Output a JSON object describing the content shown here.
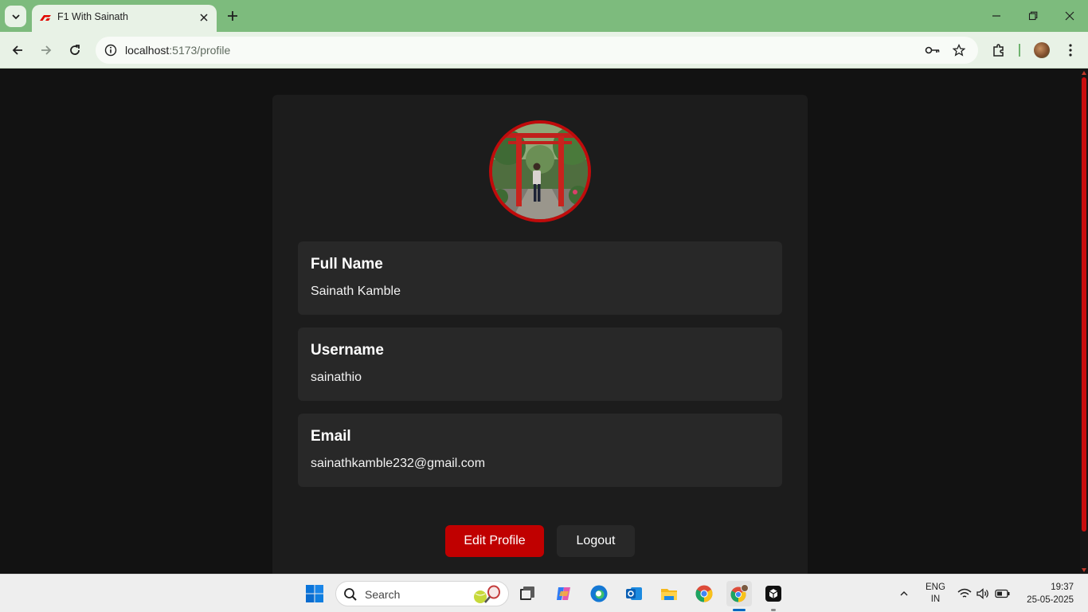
{
  "browser": {
    "tab_title": "F1 With Sainath",
    "url_host": "localhost",
    "url_path": ":5173/profile"
  },
  "profile": {
    "fields": [
      {
        "label": "Full Name",
        "value": "Sainath Kamble"
      },
      {
        "label": "Username",
        "value": "sainathio"
      },
      {
        "label": "Email",
        "value": "sainathkamble232@gmail.com"
      }
    ],
    "edit_button": "Edit Profile",
    "logout_button": "Logout"
  },
  "taskbar": {
    "search_placeholder": "Search",
    "lang_line1": "ENG",
    "lang_line2": "IN",
    "time": "19:37",
    "date": "25-05-2025"
  },
  "colors": {
    "accent_red": "#c00000",
    "page_bg": "#121212",
    "card_bg": "#1c1c1c",
    "field_bg": "#282828",
    "chrome_green": "#7dbb7d"
  },
  "icons": [
    "tab-search-icon",
    "f1-favicon-icon",
    "close-icon",
    "plus-icon",
    "minimize-icon",
    "restore-icon",
    "back-arrow-icon",
    "forward-arrow-icon",
    "reload-icon",
    "site-info-icon",
    "password-key-icon",
    "bookmark-star-icon",
    "extensions-icon",
    "more-menu-icon",
    "windows-start-icon",
    "search-icon",
    "task-view-icon",
    "copilot-icon",
    "edge-icon",
    "outlook-icon",
    "file-explorer-icon",
    "chrome-icon",
    "chrome-profile-icon",
    "app-icon",
    "chevron-up-icon",
    "wifi-icon",
    "volume-icon",
    "battery-icon"
  ]
}
